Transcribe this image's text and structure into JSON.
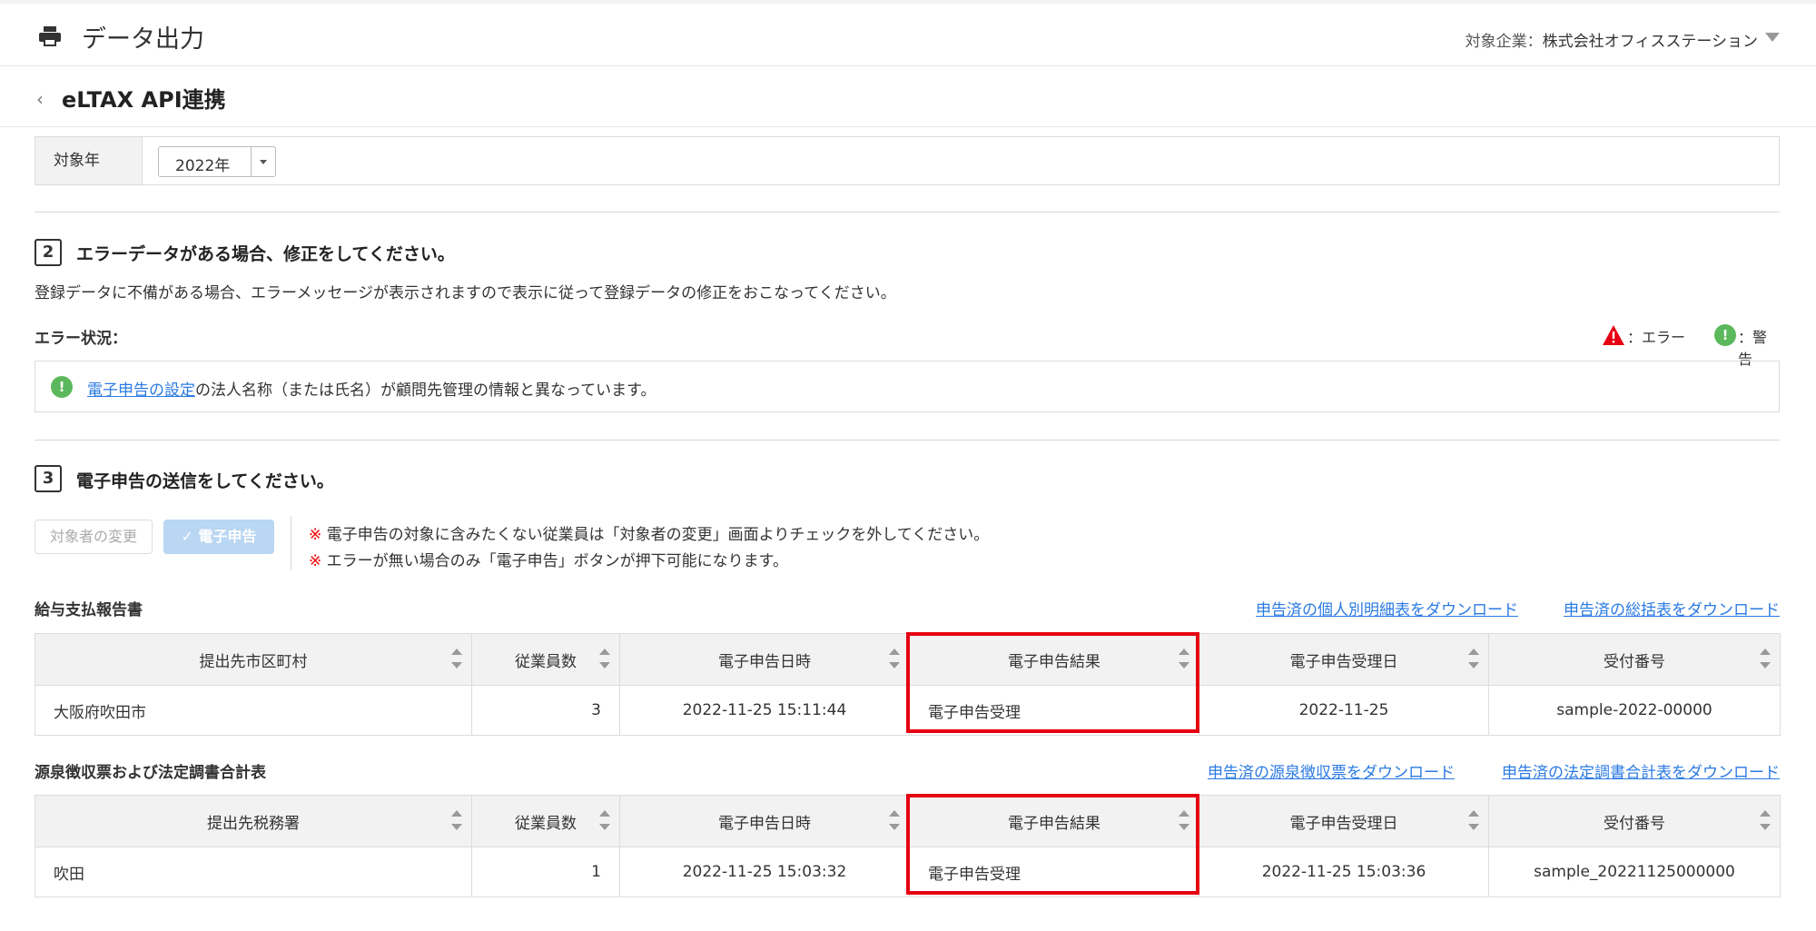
{
  "header": {
    "title": "データ出力",
    "company_label": "対象企業：",
    "company_name": "株式会社オフィスステーション"
  },
  "subheader": {
    "title": "eLTAX API連携"
  },
  "year_filter": {
    "label": "対象年",
    "value": "2022年"
  },
  "step2": {
    "number": "2",
    "title": "エラーデータがある場合、修正をしてください。",
    "description": "登録データに不備がある場合、エラーメッセージが表示されますので表示に従って登録データの修正をおこなってください。",
    "status_label": "エラー状況：",
    "legend_error": "：エラー",
    "legend_warning": "：警告",
    "warning_link": "電子申告の設定",
    "warning_text": "の法人名称（または氏名）が顧問先管理の情報と異なっています。"
  },
  "step3": {
    "number": "3",
    "title": "電子申告の送信をしてください。",
    "btn_change_target": "対象者の変更",
    "btn_efile": "✓ 電子申告",
    "note_mark": "※",
    "note1": "電子申告の対象に含みたくない従業員は「対象者の変更」画面よりチェックを外してください。",
    "note2": "エラーが無い場合のみ「電子申告」ボタンが押下可能になります。"
  },
  "salary_report": {
    "label": "給与支払報告書",
    "dl_individual": "申告済の個人別明細表をダウンロード",
    "dl_summary": "申告済の総括表をダウンロード",
    "columns": [
      "提出先市区町村",
      "従業員数",
      "電子申告日時",
      "電子申告結果",
      "電子申告受理日",
      "受付番号"
    ],
    "rows": [
      {
        "dest": "大阪府吹田市",
        "count": "3",
        "datetime": "2022-11-25 15:11:44",
        "result": "電子申告受理",
        "accepted": "2022-11-25",
        "receipt": "sample-2022-00000"
      }
    ]
  },
  "withholding": {
    "label": "源泉徴収票および法定調書合計表",
    "dl_slip": "申告済の源泉徴収票をダウンロード",
    "dl_total": "申告済の法定調書合計表をダウンロード",
    "columns": [
      "提出先税務署",
      "従業員数",
      "電子申告日時",
      "電子申告結果",
      "電子申告受理日",
      "受付番号"
    ],
    "rows": [
      {
        "dest": "吹田",
        "count": "1",
        "datetime": "2022-11-25 15:03:32",
        "result": "電子申告受理",
        "accepted": "2022-11-25 15:03:36",
        "receipt": "sample_20221125000000"
      }
    ]
  },
  "colors": {
    "highlight": "#e60012",
    "link": "#2a7ae2",
    "error_icon": "#e60012",
    "warning_icon": "#5cb85c"
  }
}
